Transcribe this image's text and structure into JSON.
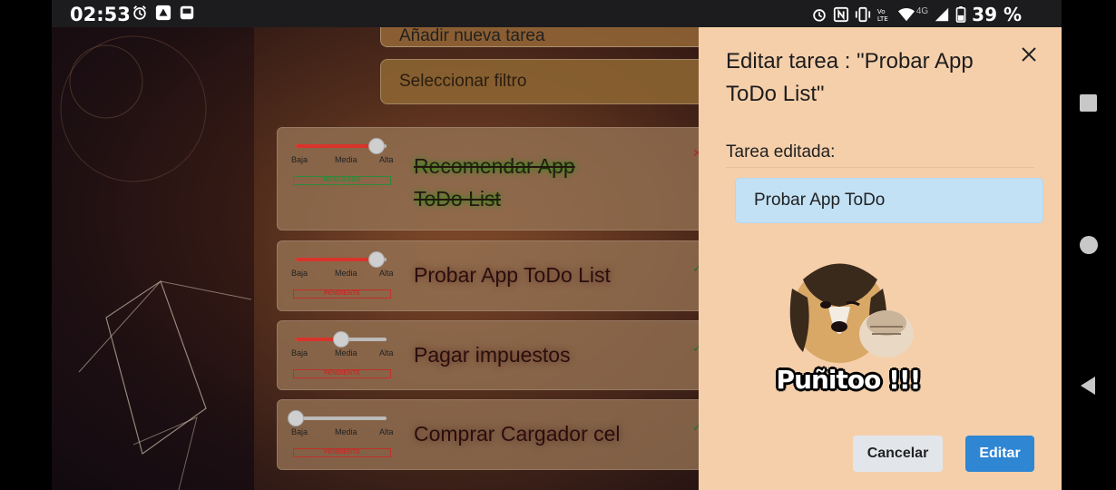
{
  "status_bar": {
    "time": "02:53",
    "left_icons": [
      "alarm-icon",
      "app-notification-icon",
      "app-notification-icon-2"
    ],
    "right_icons": [
      "alarm-icon",
      "nfc-icon",
      "vibrate-icon",
      "volte-icon",
      "wifi-icon",
      "signal-icon",
      "battery-icon"
    ],
    "network_label": "4G",
    "battery_percent": "39 %"
  },
  "background_app": {
    "add_task_placeholder": "Añadir nueva tarea",
    "filter_placeholder": "Seleccionar filtro",
    "priority_labels": {
      "low": "Baja",
      "medium": "Media",
      "high": "Alta"
    },
    "tasks": [
      {
        "title": "Recomendar App ToDo List",
        "status": "REALIZADA",
        "done": true,
        "priority_level": 1.0
      },
      {
        "title": "Probar App ToDo List",
        "status": "PENDIENTE",
        "done": false,
        "priority_level": 1.0
      },
      {
        "title": "Pagar impuestos",
        "status": "PENDIENTE",
        "done": false,
        "priority_level": 0.5
      },
      {
        "title": "Comprar Cargador cel",
        "status": "PENDIENTE",
        "done": false,
        "priority_level": 0.0
      }
    ]
  },
  "drawer": {
    "title": "Editar tarea : \"Probar App ToDo List\"",
    "field_label": "Tarea editada:",
    "field_value": "Probar App ToDo",
    "sticker_caption": "Puñitoo !!!",
    "cancel_label": "Cancelar",
    "edit_label": "Editar"
  },
  "colors": {
    "drawer_bg": "#f5cfaa",
    "edit_button": "#2f86d3",
    "cancel_button": "#e2e6ea",
    "input_bg": "#c2e1f5",
    "done_badge": "#2e8b3a",
    "pending_badge": "#c0302a"
  }
}
